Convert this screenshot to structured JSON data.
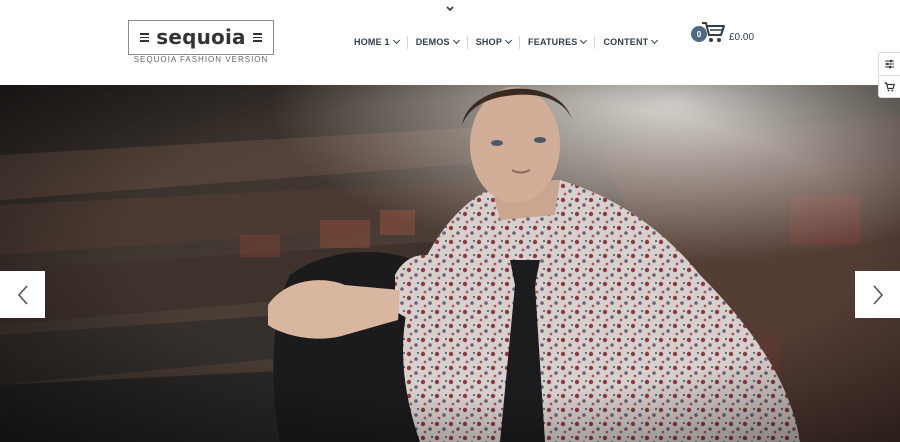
{
  "header": {
    "logo_text": "sequoia",
    "tagline": "SEQUOIA FASHION VERSION"
  },
  "nav": {
    "items": [
      {
        "label": "HOME 1",
        "icon": "chevron-down-icon"
      },
      {
        "label": "DEMOS",
        "icon": "chevron-down-icon"
      },
      {
        "label": "SHOP",
        "icon": "chevron-down-icon"
      },
      {
        "label": "FEATURES",
        "icon": "chevron-down-icon"
      },
      {
        "label": "CONTENT",
        "icon": "chevron-down-icon"
      }
    ]
  },
  "cart": {
    "count": "0",
    "total": "£0.00",
    "icon": "cart-icon"
  },
  "side_tools": {
    "items": [
      {
        "icon": "sliders-icon"
      },
      {
        "icon": "cart-icon"
      }
    ]
  },
  "slider": {
    "prev_icon": "chevron-left-icon",
    "next_icon": "chevron-right-icon",
    "image": "hero-photo"
  },
  "colors": {
    "nav_text": "#2f3e4a",
    "badge": "#4f6a80",
    "header_bg": "#ffffff"
  }
}
